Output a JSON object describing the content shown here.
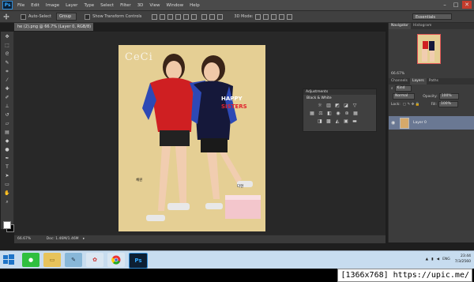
{
  "app": {
    "logo": "Ps",
    "window_buttons": [
      "–",
      "□",
      "✕"
    ]
  },
  "menu": [
    "File",
    "Edit",
    "Image",
    "Layer",
    "Type",
    "Select",
    "Filter",
    "3D",
    "View",
    "Window",
    "Help"
  ],
  "options_bar": {
    "auto_select_label": "Auto-Select",
    "auto_select_value": "Group",
    "show_transform_label": "Show Transform Controls",
    "mode_3d_label": "3D Mode:",
    "workspace": "Essentials"
  },
  "document_tab": {
    "title": "he (2).png @ 66.7% (Layer 0, RGB/8)",
    "close": "×"
  },
  "tools": [
    "move-tool",
    "marquee-tool",
    "lasso-tool",
    "quick-select-tool",
    "crop-tool",
    "eyedropper-tool",
    "healing-tool",
    "brush-tool",
    "clone-stamp-tool",
    "history-brush-tool",
    "eraser-tool",
    "gradient-tool",
    "blur-tool",
    "dodge-tool",
    "pen-tool",
    "type-tool",
    "path-select-tool",
    "shape-tool",
    "hand-tool",
    "zoom-tool"
  ],
  "image": {
    "brand": "CeCi",
    "happy_line1": "HAPPY",
    "happy_line2": "SISTERS",
    "caption_left": "채원",
    "caption_right": "다현"
  },
  "status_bar": {
    "zoom": "66.67%",
    "doc_info": "Doc: 1.46M/1.46M"
  },
  "adjustments": {
    "title": "Adjustments",
    "subtitle": "Add an adjustment: Black & White",
    "subtitle_short": "Black & White"
  },
  "navigator": {
    "tabs": [
      "Navigator",
      "Histogram"
    ],
    "zoom": "66.67%"
  },
  "layers_panel": {
    "tabs": [
      "Channels",
      "Layers",
      "Paths"
    ],
    "kind_label": "Kind",
    "blend_mode": "Normal",
    "opacity_label": "Opacity:",
    "opacity_value": "100%",
    "lock_label": "Lock:",
    "fill_label": "Fill:",
    "fill_value": "100%",
    "layer_name": "Layer 0"
  },
  "taskbar": {
    "apps": [
      "line-app",
      "file-explorer",
      "notepad-app",
      "paint-app",
      "chrome-browser",
      "photoshop-app"
    ],
    "language": "ENG",
    "time": "23:44",
    "date": "7/3/2560"
  },
  "resolution_info": "[1366x768] https://upic.me/",
  "colors": {
    "canvas_bg": "#282828",
    "panel_bg": "#3c3c3c",
    "selected_layer": "#6a7893",
    "taskbar": "#c7dcef",
    "accent_red": "#e0212c"
  }
}
